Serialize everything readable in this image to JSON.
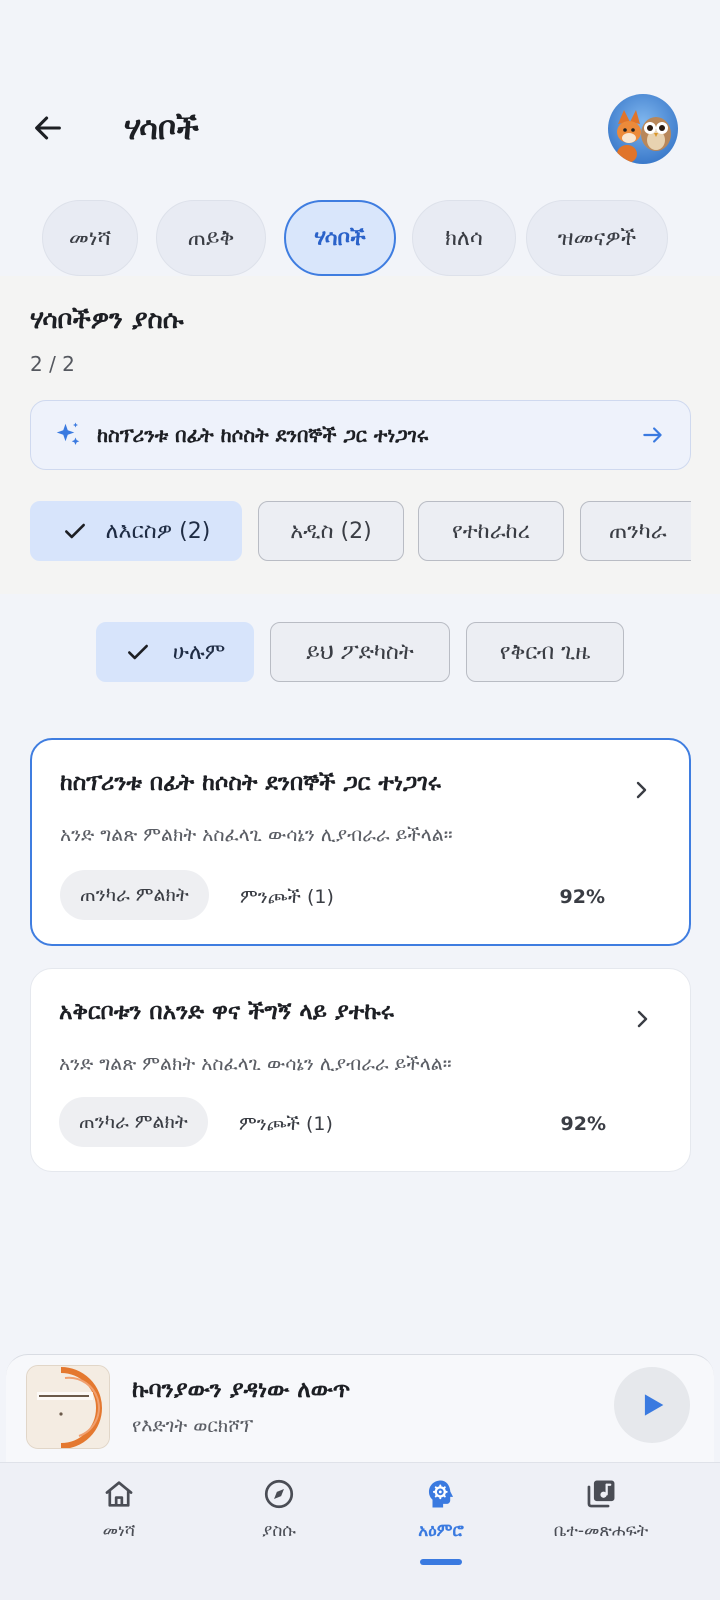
{
  "header": {
    "title": "ሃሳቦች",
    "back_icon": "arrow-left-icon",
    "avatar_icon": "fox-owl-avatar"
  },
  "tabs": [
    {
      "label": "መነሻ",
      "active": false
    },
    {
      "label": "ጠይቅ",
      "active": false
    },
    {
      "label": "ሃሳቦች",
      "active": true
    },
    {
      "label": "ክለሳ",
      "active": false
    },
    {
      "label": "ዝመናዎች",
      "active": false
    }
  ],
  "section": {
    "title": "ሃሳቦችዎን ያስሱ",
    "count": "2 / 2",
    "suggestion": "ከስፕሪንቱ በፊት ከሶስት ደንበኞች ጋር ተነጋገሩ"
  },
  "filters": {
    "chips": [
      {
        "label": "ለእርስዎ (2)",
        "selected": true
      },
      {
        "label": "አዲስ (2)",
        "selected": false
      },
      {
        "label": "የተከራከረ",
        "selected": false
      },
      {
        "label": "ጠንካራ",
        "selected": false
      }
    ],
    "scope": [
      {
        "label": "ሁሉም",
        "selected": true
      },
      {
        "label": "ይህ ፖድካስት",
        "selected": false
      },
      {
        "label": "የቅርብ ጊዜ",
        "selected": false
      }
    ]
  },
  "cards": [
    {
      "title": "ከስፕሪንቱ በፊት ከሶስት ደንበኞች ጋር ተነጋገሩ",
      "description": "አንድ ግልጽ ምልክት አስፈላጊ ውሳኔን ሊያብራራ ይችላል።",
      "tag": "ጠንካራ ምልክት",
      "sources": "ምንጮች (1)",
      "confidence": "92%"
    },
    {
      "title": "አቅርቦቱን በአንድ ዋና ችግኝ ላይ ያተኩሩ",
      "description": "አንድ ግልጽ ምልክት አስፈላጊ ውሳኔን ሊያብራራ ይችላል።",
      "tag": "ጠንካራ ምልክት",
      "sources": "ምንጮች (1)",
      "confidence": "92%"
    }
  ],
  "player": {
    "title": "ኩባንያውን ያዳነው ለውጥ",
    "subtitle": "የእድገት ወርክሾፕ",
    "play_icon": "play-icon"
  },
  "nav": [
    {
      "label": "መነሻ",
      "icon": "home-icon",
      "active": false
    },
    {
      "label": "ያስሱ",
      "icon": "compass-icon",
      "active": false
    },
    {
      "label": "አዕምሮ",
      "icon": "brain-gear-icon",
      "active": true
    },
    {
      "label": "ቤተ-መጽሐፍት",
      "icon": "music-library-icon",
      "active": false
    }
  ],
  "colors": {
    "accent": "#3a7ae0",
    "background": "#f2f4f9",
    "selected_chip": "#d7e4fb"
  }
}
